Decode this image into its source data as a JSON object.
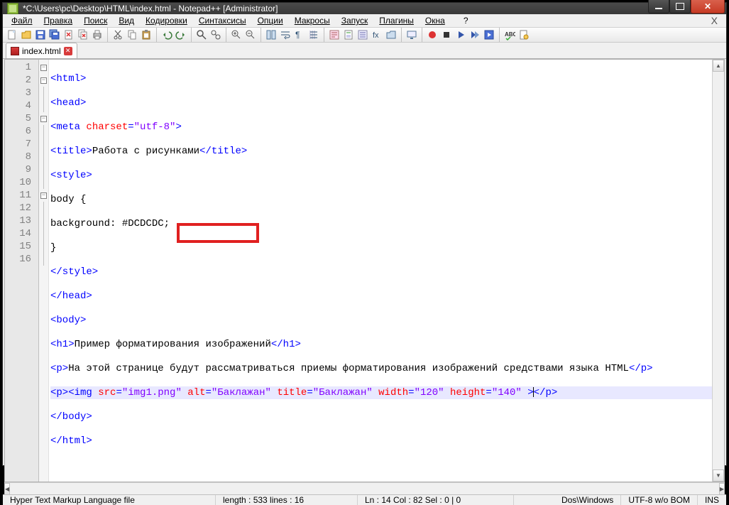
{
  "window": {
    "title": "*C:\\Users\\pc\\Desktop\\HTML\\index.html - Notepad++ [Administrator]"
  },
  "menu": {
    "file": "Файл",
    "edit": "Правка",
    "search": "Поиск",
    "view": "Вид",
    "encoding": "Кодировки",
    "syntax": "Синтаксисы",
    "options": "Опции",
    "macros": "Макросы",
    "run": "Запуск",
    "plugins": "Плагины",
    "windows": "Окна",
    "help": "?"
  },
  "tab": {
    "filename": "index.html"
  },
  "gutter": {
    "lines": [
      "1",
      "2",
      "3",
      "4",
      "5",
      "6",
      "7",
      "8",
      "9",
      "10",
      "11",
      "12",
      "13",
      "14",
      "15",
      "16"
    ]
  },
  "code": {
    "l1": {
      "open": "<html>"
    },
    "l2": {
      "open": "<head>"
    },
    "l3": {
      "open": "<meta ",
      "attr1": "charset",
      "eq": "=",
      "val1": "\"utf-8\"",
      "close": ">"
    },
    "l4": {
      "open": "<title>",
      "text": "Работа с рисунками",
      "close": "</title>"
    },
    "l5": {
      "open": "<style>"
    },
    "l6": {
      "text": "body {"
    },
    "l7": {
      "text": "background: #DCDCDC;"
    },
    "l8": {
      "text": "}"
    },
    "l9": {
      "close": "</style>"
    },
    "l10": {
      "close": "</head>"
    },
    "l11": {
      "open": "<body>"
    },
    "l12": {
      "open": "<h1>",
      "text": "Пример форматирования изображений",
      "close": "</h1>"
    },
    "l13": {
      "open": "<p>",
      "text": "На этой странице будут рассматриваться приемы форматирования изображений средствами языка HTML",
      "close": "</p>"
    },
    "l14": {
      "open": "<p><img ",
      "a1": "src",
      "v1": "\"img1.png\"",
      "a2": "alt",
      "v2": "\"Баклажан\"",
      "a3": "title",
      "v3": "\"Баклажан\"",
      "a4": "width",
      "v4": "\"120\"",
      "a5": "height",
      "v5": "\"140\"",
      "mid": " >",
      "close": "</p>"
    },
    "l15": {
      "close": "</body>"
    },
    "l16": {
      "close": "</html>"
    }
  },
  "status": {
    "filetype": "Hyper Text Markup Language file",
    "length": "length : 533    lines : 16",
    "pos": "Ln : 14    Col : 82    Sel : 0 | 0",
    "eol": "Dos\\Windows",
    "enc": "UTF-8 w/o BOM",
    "mode": "INS"
  },
  "icons": {
    "new": "new-file-icon",
    "open": "open-file-icon",
    "save": "save-icon",
    "saveall": "save-all-icon",
    "closefile": "close-file-icon",
    "closeall": "close-all-icon",
    "print": "print-icon",
    "cut": "cut-icon",
    "copy": "copy-icon",
    "paste": "paste-icon",
    "undo": "undo-icon",
    "redo": "redo-icon",
    "find": "find-icon",
    "replace": "replace-icon",
    "zoomin": "zoom-in-icon",
    "zoomout": "zoom-out-icon",
    "sync": "sync-scroll-icon",
    "wrap": "word-wrap-icon",
    "allchars": "show-all-chars-icon",
    "indent": "indent-guide-icon",
    "lang": "user-lang-icon",
    "folder": "doc-map-icon",
    "func": "function-list-icon",
    "rec": "macro-record-icon",
    "stop": "macro-stop-icon",
    "play": "macro-play-icon",
    "playmulti": "macro-play-multi-icon",
    "savemacro": "macro-save-icon",
    "spell": "spellcheck-icon",
    "about": "about-icon"
  }
}
